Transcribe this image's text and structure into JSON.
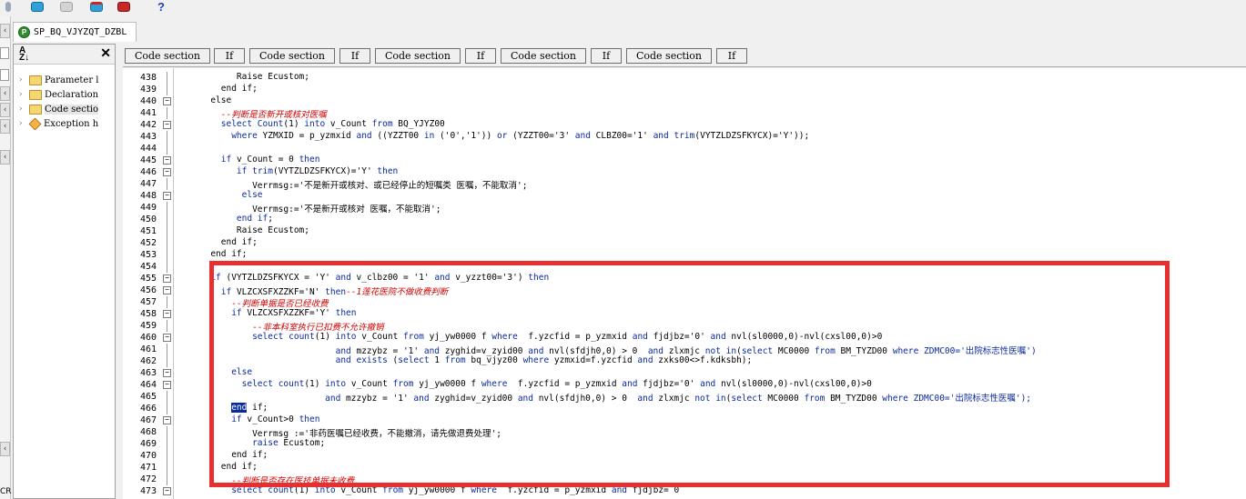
{
  "toolbar": {
    "buttons": [
      {
        "name": "database-icon",
        "color": "#2fa1d8"
      },
      {
        "name": "database-gray-icon",
        "color": "#c8c8c8"
      },
      {
        "name": "database-red-icon",
        "color": "#2fa1d8"
      },
      {
        "name": "database-edit-icon",
        "color": "#c62828"
      }
    ],
    "help": "?"
  },
  "tab": {
    "icon": "P",
    "title": "SP_BQ_VJYZQT_DZBL"
  },
  "left_strip": {
    "label": "CR"
  },
  "structure": {
    "sort_icon": "A Z",
    "close": "✕",
    "items": [
      {
        "label": "Parameter l",
        "icon": "folder-icon"
      },
      {
        "label": "Declaration",
        "icon": "folder-icon"
      },
      {
        "label": "Code sectio",
        "icon": "folder-icon",
        "selected": true
      },
      {
        "label": "Exception h",
        "icon": "exception-icon"
      }
    ]
  },
  "sections": [
    "Code section",
    "If",
    "Code section",
    "If",
    "Code section",
    "If",
    "Code section",
    "If",
    "Code section",
    "If"
  ],
  "editor": {
    "lines": [
      {
        "no": "438",
        "fold": "line",
        "parts": [
          {
            "t": "           Raise Ecustom;",
            "c": "n"
          }
        ]
      },
      {
        "no": "439",
        "fold": "line",
        "parts": [
          {
            "t": "        end if;",
            "c": "n"
          }
        ]
      },
      {
        "no": "440",
        "fold": "box",
        "parts": [
          {
            "t": "      else",
            "c": "n"
          }
        ]
      },
      {
        "no": "441",
        "fold": "line",
        "parts": [
          {
            "t": "        --判断是否新开或核对医嘱",
            "c": "c"
          }
        ]
      },
      {
        "no": "442",
        "fold": "box",
        "parts": [
          {
            "t": "        select ",
            "c": "k"
          },
          {
            "t": "Count",
            "c": "k"
          },
          {
            "t": "(1) ",
            "c": "n"
          },
          {
            "t": "into",
            "c": "k"
          },
          {
            "t": " v_Count ",
            "c": "n"
          },
          {
            "t": "from",
            "c": "k"
          },
          {
            "t": " BQ_YJYZ00",
            "c": "n"
          }
        ]
      },
      {
        "no": "443",
        "fold": "line",
        "parts": [
          {
            "t": "          ",
            "c": "n"
          },
          {
            "t": "where",
            "c": "k"
          },
          {
            "t": " YZMXID = p_yzmxid ",
            "c": "n"
          },
          {
            "t": "and",
            "c": "k"
          },
          {
            "t": " ((YZZT00 ",
            "c": "n"
          },
          {
            "t": "in",
            "c": "k"
          },
          {
            "t": " ('0','1')) ",
            "c": "n"
          },
          {
            "t": "or",
            "c": "k"
          },
          {
            "t": " (YZZT00='3' ",
            "c": "n"
          },
          {
            "t": "and",
            "c": "k"
          },
          {
            "t": " CLBZ00='1' ",
            "c": "n"
          },
          {
            "t": "and",
            "c": "k"
          },
          {
            "t": " ",
            "c": "n"
          },
          {
            "t": "trim",
            "c": "k"
          },
          {
            "t": "(VYTZLDZSFKYCX)='Y'));",
            "c": "n"
          }
        ]
      },
      {
        "no": "444",
        "fold": "line",
        "parts": [
          {
            "t": "",
            "c": "n"
          }
        ]
      },
      {
        "no": "445",
        "fold": "box",
        "parts": [
          {
            "t": "        ",
            "c": "n"
          },
          {
            "t": "if",
            "c": "k"
          },
          {
            "t": " v_Count = 0 ",
            "c": "n"
          },
          {
            "t": "then",
            "c": "k"
          }
        ]
      },
      {
        "no": "446",
        "fold": "box",
        "parts": [
          {
            "t": "           ",
            "c": "n"
          },
          {
            "t": "if",
            "c": "k"
          },
          {
            "t": " ",
            "c": "n"
          },
          {
            "t": "trim",
            "c": "k"
          },
          {
            "t": "(VYTZLDZSFKYCX)='Y' ",
            "c": "n"
          },
          {
            "t": "then",
            "c": "k"
          }
        ]
      },
      {
        "no": "447",
        "fold": "line",
        "parts": [
          {
            "t": "              Verrmsg:='不是新开或核对、或已经停止的短嘱类 医嘱，不能取消';",
            "c": "n"
          }
        ]
      },
      {
        "no": "448",
        "fold": "box",
        "parts": [
          {
            "t": "            ",
            "c": "n"
          },
          {
            "t": "else",
            "c": "k"
          }
        ]
      },
      {
        "no": "449",
        "fold": "line",
        "parts": [
          {
            "t": "              Verrmsg:='不是新开或核对 医嘱，不能取消';",
            "c": "n"
          }
        ]
      },
      {
        "no": "450",
        "fold": "line",
        "parts": [
          {
            "t": "           ",
            "c": "n"
          },
          {
            "t": "end if",
            "c": "k"
          },
          {
            "t": ";",
            "c": "n"
          }
        ]
      },
      {
        "no": "451",
        "fold": "line",
        "parts": [
          {
            "t": "           Raise Ecustom;",
            "c": "n"
          }
        ]
      },
      {
        "no": "452",
        "fold": "line",
        "parts": [
          {
            "t": "        end if;",
            "c": "n"
          }
        ]
      },
      {
        "no": "453",
        "fold": "line",
        "parts": [
          {
            "t": "      end if;",
            "c": "n"
          }
        ]
      },
      {
        "no": "454",
        "fold": "line",
        "parts": [
          {
            "t": "",
            "c": "n"
          }
        ]
      },
      {
        "no": "455",
        "fold": "box",
        "parts": [
          {
            "t": "      ",
            "c": "n"
          },
          {
            "t": "if",
            "c": "k"
          },
          {
            "t": " (VYTZLDZSFKYCX = 'Y' ",
            "c": "n"
          },
          {
            "t": "and",
            "c": "k"
          },
          {
            "t": " v_clbz00 = '1' ",
            "c": "n"
          },
          {
            "t": "and",
            "c": "k"
          },
          {
            "t": " v_yzzt00='3') ",
            "c": "n"
          },
          {
            "t": "then",
            "c": "k"
          }
        ]
      },
      {
        "no": "456",
        "fold": "box",
        "parts": [
          {
            "t": "        ",
            "c": "n"
          },
          {
            "t": "if",
            "c": "k"
          },
          {
            "t": " VLZCXSFXZZKF='N' ",
            "c": "n"
          },
          {
            "t": "then",
            "c": "k"
          },
          {
            "t": "--1莲花医院不做收费判断",
            "c": "c"
          }
        ]
      },
      {
        "no": "457",
        "fold": "line",
        "parts": [
          {
            "t": "          --判断单据是否已经收费",
            "c": "c"
          }
        ]
      },
      {
        "no": "458",
        "fold": "box",
        "parts": [
          {
            "t": "          ",
            "c": "n"
          },
          {
            "t": "if",
            "c": "k"
          },
          {
            "t": " VLZCXSFXZZKF='Y' ",
            "c": "n"
          },
          {
            "t": "then",
            "c": "k"
          }
        ]
      },
      {
        "no": "459",
        "fold": "line",
        "parts": [
          {
            "t": "              --非本科室执行已扣费不允许撤销",
            "c": "c"
          }
        ]
      },
      {
        "no": "460",
        "fold": "box",
        "parts": [
          {
            "t": "              ",
            "c": "n"
          },
          {
            "t": "select",
            "c": "k"
          },
          {
            "t": " ",
            "c": "n"
          },
          {
            "t": "count",
            "c": "k"
          },
          {
            "t": "(1) ",
            "c": "n"
          },
          {
            "t": "into",
            "c": "k"
          },
          {
            "t": " v_Count ",
            "c": "n"
          },
          {
            "t": "from",
            "c": "k"
          },
          {
            "t": " yj_yw0000 f ",
            "c": "n"
          },
          {
            "t": "where",
            "c": "k"
          },
          {
            "t": "  f.yzcfid = p_yzmxid ",
            "c": "n"
          },
          {
            "t": "and",
            "c": "k"
          },
          {
            "t": " fjdjbz='0' ",
            "c": "n"
          },
          {
            "t": "and",
            "c": "k"
          },
          {
            "t": " nvl(sl0000,0)-nvl(cxsl00,0)>0",
            "c": "n"
          }
        ]
      },
      {
        "no": "461",
        "fold": "line",
        "parts": [
          {
            "t": "                              ",
            "c": "n"
          },
          {
            "t": "and",
            "c": "k"
          },
          {
            "t": " mzzybz = '1' ",
            "c": "n"
          },
          {
            "t": "and",
            "c": "k"
          },
          {
            "t": " zyghid=v_zyid00 ",
            "c": "n"
          },
          {
            "t": "and",
            "c": "k"
          },
          {
            "t": " nvl(sfdjh0,0) > 0  ",
            "c": "n"
          },
          {
            "t": "and",
            "c": "k"
          },
          {
            "t": " zlxmjc ",
            "c": "n"
          },
          {
            "t": "not in",
            "c": "k"
          },
          {
            "t": "(",
            "c": "n"
          },
          {
            "t": "select",
            "c": "k"
          },
          {
            "t": " MC0000 ",
            "c": "n"
          },
          {
            "t": "from",
            "c": "k"
          },
          {
            "t": " BM_TYZD00 ",
            "c": "n"
          },
          {
            "t": "where",
            "c": "k"
          },
          {
            "t": " ZDMC00='出院标志性医嘱')",
            "c": "s"
          }
        ]
      },
      {
        "no": "462",
        "fold": "line",
        "parts": [
          {
            "t": "                              ",
            "c": "n"
          },
          {
            "t": "and exists",
            "c": "k"
          },
          {
            "t": " (",
            "c": "n"
          },
          {
            "t": "select",
            "c": "k"
          },
          {
            "t": " 1 ",
            "c": "n"
          },
          {
            "t": "from",
            "c": "k"
          },
          {
            "t": " bq_vjyz00 ",
            "c": "n"
          },
          {
            "t": "where",
            "c": "k"
          },
          {
            "t": " yzmxid=f.yzcfid ",
            "c": "n"
          },
          {
            "t": "and",
            "c": "k"
          },
          {
            "t": " zxks00<>f.kdksbh);",
            "c": "n"
          }
        ]
      },
      {
        "no": "463",
        "fold": "box",
        "parts": [
          {
            "t": "          ",
            "c": "n"
          },
          {
            "t": "else",
            "c": "k"
          }
        ]
      },
      {
        "no": "464",
        "fold": "box",
        "parts": [
          {
            "t": "            ",
            "c": "n"
          },
          {
            "t": "select",
            "c": "k"
          },
          {
            "t": " ",
            "c": "n"
          },
          {
            "t": "count",
            "c": "k"
          },
          {
            "t": "(1) ",
            "c": "n"
          },
          {
            "t": "into",
            "c": "k"
          },
          {
            "t": " v_Count ",
            "c": "n"
          },
          {
            "t": "from",
            "c": "k"
          },
          {
            "t": " yj_yw0000 f ",
            "c": "n"
          },
          {
            "t": "where",
            "c": "k"
          },
          {
            "t": "  f.yzcfid = p_yzmxid ",
            "c": "n"
          },
          {
            "t": "and",
            "c": "k"
          },
          {
            "t": " fjdjbz='0' ",
            "c": "n"
          },
          {
            "t": "and",
            "c": "k"
          },
          {
            "t": " nvl(sl0000,0)-nvl(cxsl00,0)>0",
            "c": "n"
          }
        ]
      },
      {
        "no": "465",
        "fold": "line",
        "parts": [
          {
            "t": "                            ",
            "c": "n"
          },
          {
            "t": "and",
            "c": "k"
          },
          {
            "t": " mzzybz = '1' ",
            "c": "n"
          },
          {
            "t": "and",
            "c": "k"
          },
          {
            "t": " zyghid=v_zyid00 ",
            "c": "n"
          },
          {
            "t": "and",
            "c": "k"
          },
          {
            "t": " nvl(sfdjh0,0) > 0  ",
            "c": "n"
          },
          {
            "t": "and",
            "c": "k"
          },
          {
            "t": " zlxmjc ",
            "c": "n"
          },
          {
            "t": "not in",
            "c": "k"
          },
          {
            "t": "(",
            "c": "n"
          },
          {
            "t": "select",
            "c": "k"
          },
          {
            "t": " MC0000 ",
            "c": "n"
          },
          {
            "t": "from",
            "c": "k"
          },
          {
            "t": " BM_TYZD00 ",
            "c": "n"
          },
          {
            "t": "where",
            "c": "k"
          },
          {
            "t": " ZDMC00='出院标志性医嘱');",
            "c": "s"
          }
        ]
      },
      {
        "no": "466",
        "fold": "line",
        "parts": [
          {
            "t": "          ",
            "c": "n"
          },
          {
            "t": "end",
            "c": "sel"
          },
          {
            "t": " if;",
            "c": "n"
          }
        ]
      },
      {
        "no": "467",
        "fold": "box",
        "parts": [
          {
            "t": "          ",
            "c": "n"
          },
          {
            "t": "if",
            "c": "k"
          },
          {
            "t": " v_Count>0 ",
            "c": "n"
          },
          {
            "t": "then",
            "c": "k"
          }
        ]
      },
      {
        "no": "468",
        "fold": "line",
        "parts": [
          {
            "t": "              Verrmsg :='非药医嘱已经收费，不能撤消，请先做退费处理';",
            "c": "n"
          }
        ]
      },
      {
        "no": "469",
        "fold": "line",
        "parts": [
          {
            "t": "              ",
            "c": "n"
          },
          {
            "t": "raise",
            "c": "k"
          },
          {
            "t": " Ecustom;",
            "c": "n"
          }
        ]
      },
      {
        "no": "470",
        "fold": "line",
        "parts": [
          {
            "t": "          end if;",
            "c": "n"
          }
        ]
      },
      {
        "no": "471",
        "fold": "line",
        "parts": [
          {
            "t": "        end if;",
            "c": "n"
          }
        ]
      },
      {
        "no": "472",
        "fold": "line",
        "parts": [
          {
            "t": "          --判断是否存在医技单据未收费",
            "c": "c"
          }
        ]
      },
      {
        "no": "473",
        "fold": "box",
        "parts": [
          {
            "t": "          ",
            "c": "n"
          },
          {
            "t": "select",
            "c": "k"
          },
          {
            "t": " ",
            "c": "n"
          },
          {
            "t": "count",
            "c": "k"
          },
          {
            "t": "(1) ",
            "c": "n"
          },
          {
            "t": "into",
            "c": "k"
          },
          {
            "t": " v_Count ",
            "c": "n"
          },
          {
            "t": "from",
            "c": "k"
          },
          {
            "t": " yj_yw0000 f ",
            "c": "n"
          },
          {
            "t": "where",
            "c": "k"
          },
          {
            "t": "  f.yzcfid = p_yzmxid ",
            "c": "n"
          },
          {
            "t": "and",
            "c": "k"
          },
          {
            "t": " fjdjbz= 0",
            "c": "n"
          }
        ]
      }
    ]
  },
  "colors": {
    "keyword": "#0a2a9c",
    "comment": "#d00000",
    "highlight": "#e82f2f"
  }
}
